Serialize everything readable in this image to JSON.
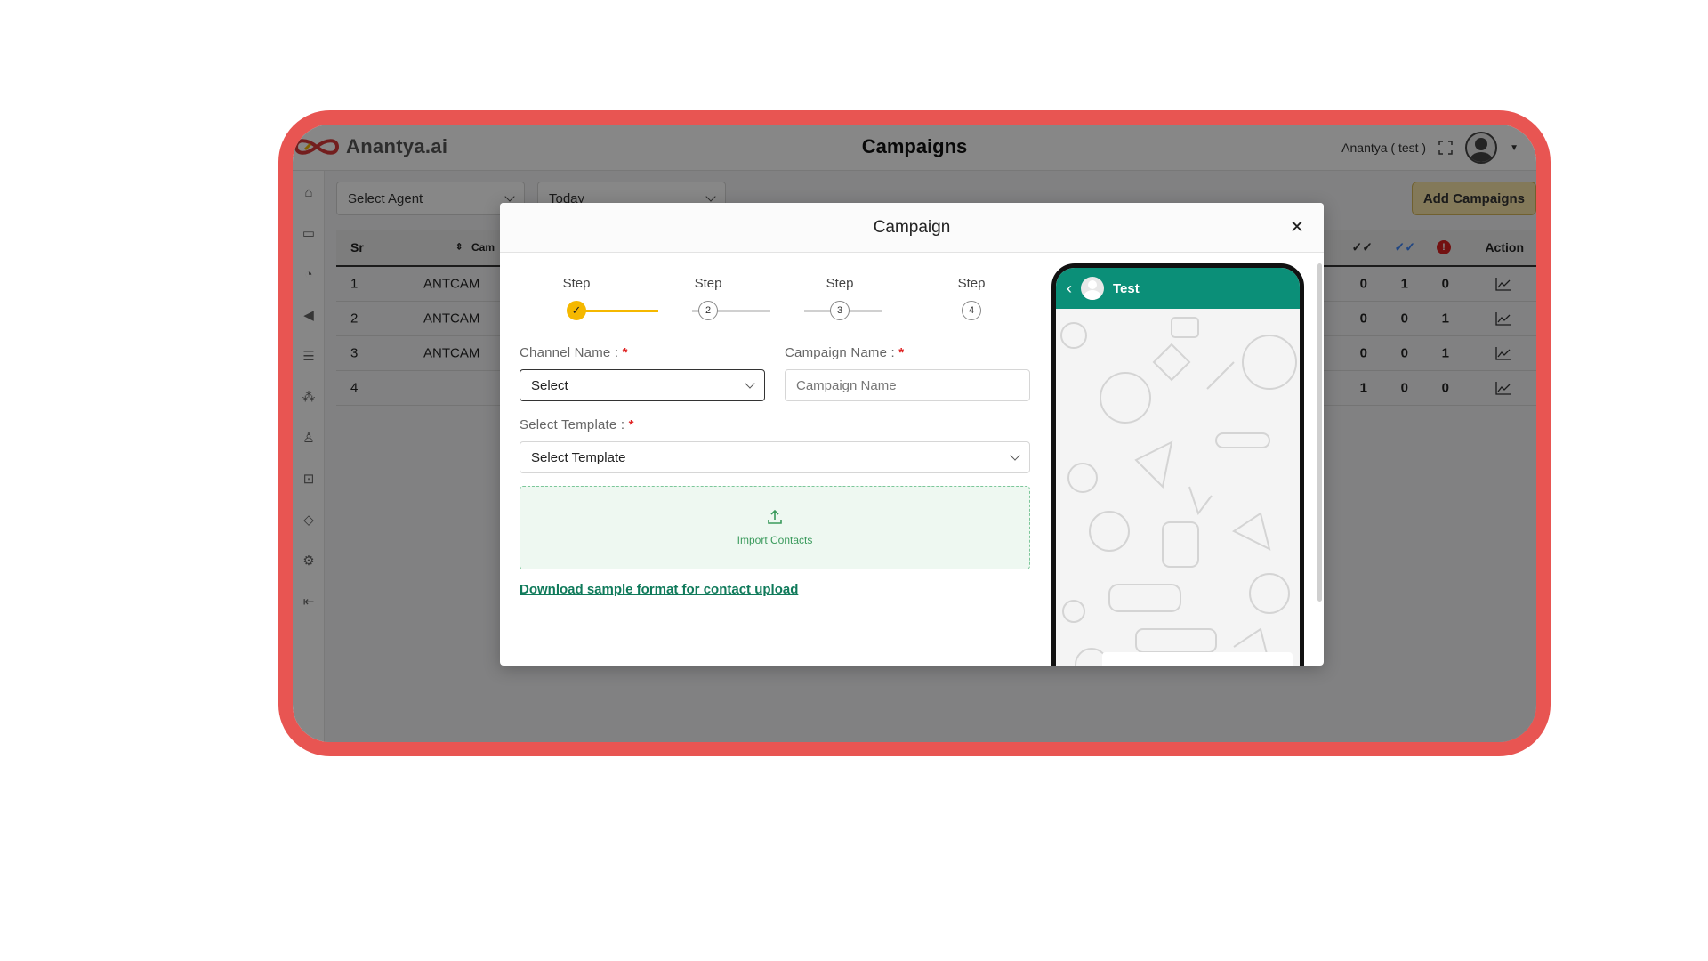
{
  "app": {
    "logo_text": "Anantya.ai",
    "page_title": "Campaigns",
    "user_name": "Anantya ( test )",
    "add_button": "Add Campaigns"
  },
  "filters": {
    "agent": "Select Agent",
    "date": "Today"
  },
  "table": {
    "headers": {
      "sr": "Sr",
      "campaign": "Cam",
      "action": "Action"
    },
    "rows": [
      {
        "sr": "1",
        "name": "ANTCAM",
        "a": "0",
        "b": "1",
        "c": "0"
      },
      {
        "sr": "2",
        "name": "ANTCAM",
        "a": "0",
        "b": "0",
        "c": "1"
      },
      {
        "sr": "3",
        "name": "ANTCAM",
        "a": "0",
        "b": "0",
        "c": "1"
      },
      {
        "sr": "4",
        "name": "",
        "a": "1",
        "b": "0",
        "c": "0"
      }
    ]
  },
  "modal": {
    "title": "Campaign",
    "close": "×",
    "steps": [
      {
        "label": "Step",
        "number": "✓",
        "done": true
      },
      {
        "label": "Step",
        "number": "2",
        "done": false
      },
      {
        "label": "Step",
        "number": "3",
        "done": false
      },
      {
        "label": "Step",
        "number": "4",
        "done": false
      }
    ],
    "channel_label": "Channel Name :",
    "channel_value": "Select",
    "campaign_label": "Campaign Name :",
    "campaign_placeholder": "Campaign Name",
    "template_label": "Select Template :",
    "template_value": "Select Template",
    "required_mark": "*",
    "import_text": "Import Contacts",
    "download_link": "Download sample format for contact upload"
  },
  "preview": {
    "contact_name": "Test",
    "back": "‹"
  },
  "colors": {
    "frame": "#e85552",
    "accent": "#f5b800",
    "whatsapp": "#0b8f78",
    "link": "#0f7a5a"
  }
}
